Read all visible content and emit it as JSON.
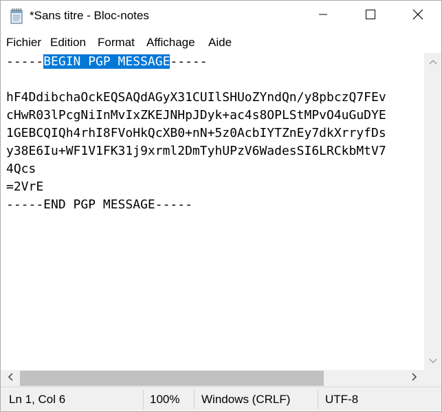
{
  "window": {
    "title": "*Sans titre - Bloc-notes"
  },
  "icons": {
    "app": "notepad-icon",
    "minimize": "minimize-icon",
    "maximize": "maximize-icon",
    "close": "close-icon",
    "scroll_up": "chevron-up-icon",
    "scroll_down": "chevron-down-icon",
    "scroll_left": "chevron-left-icon",
    "scroll_right": "chevron-right-icon"
  },
  "menu": {
    "items": [
      "Fichier",
      "Edition",
      "Format",
      "Affichage",
      "Aide"
    ]
  },
  "editor": {
    "line0_prefix": "-----",
    "line0_selected": "BEGIN PGP MESSAGE",
    "line0_suffix": "-----",
    "lines": [
      "",
      "hF4DdibchaOckEQSAQdAGyX31CUIlSHUoZYndQn/y8pbczQ7FEv",
      "cHwR03lPcgNiInMvIxZKEJNHpJDyk+ac4s8OPLStMPvO4uGuDYE",
      "1GEBCQIQh4rhI8FVoHkQcXB0+nN+5z0AcbIYTZnEy7dkXrryfDs",
      "y38E6Iu+WF1V1FK31j9xrml2DmTyhUPzV6WadesSI6LRCkbMtV7",
      "4Qcs",
      "=2VrE",
      "-----END PGP MESSAGE-----"
    ]
  },
  "status": {
    "position": "Ln 1, Col 6",
    "zoom": "100%",
    "line_ending": "Windows (CRLF)",
    "encoding": "UTF-8"
  },
  "colors": {
    "selection": "#0078d7",
    "statusbar_bg": "#f0f0f0",
    "scrollbar_thumb": "#c1c1c1"
  }
}
